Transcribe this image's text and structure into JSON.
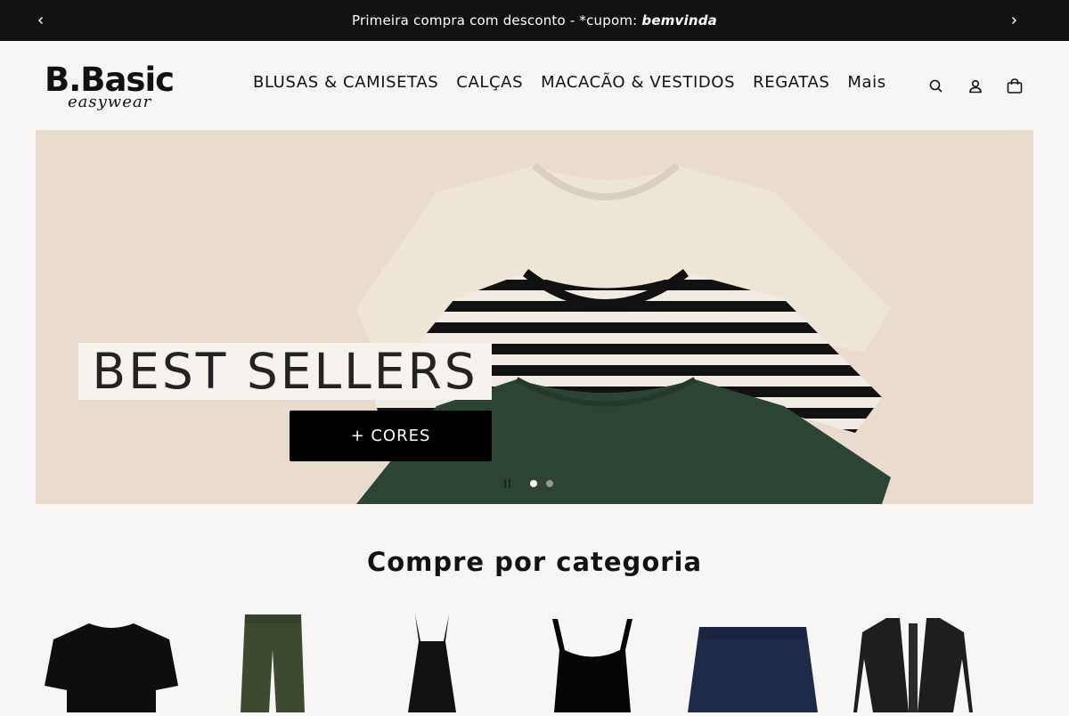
{
  "announcement": {
    "text": "Primeira compra com desconto - *cupom: ",
    "code": "bemvinda"
  },
  "header": {
    "brand": "B.Basic",
    "tagline": "easywear",
    "nav": [
      "BLUSAS & CAMISETAS",
      "CALÇAS",
      "MACACÃO & VESTIDOS",
      "REGATAS",
      "Mais"
    ],
    "icons": [
      "search-icon",
      "account-icon",
      "cart-icon"
    ]
  },
  "hero": {
    "title": "BEST SELLERS",
    "button": "+ CORES",
    "slides_total": 2,
    "active_slide": 1
  },
  "categories": {
    "title": "Compre por categoria",
    "items": [
      "t-shirt",
      "pants",
      "dress",
      "tank-top",
      "shorts",
      "cardigan"
    ]
  },
  "colors": {
    "announce_bg": "#121212",
    "hero_bg": "#eadbcf",
    "button_bg": "#000000",
    "page_bg": "#f7f6f4"
  }
}
